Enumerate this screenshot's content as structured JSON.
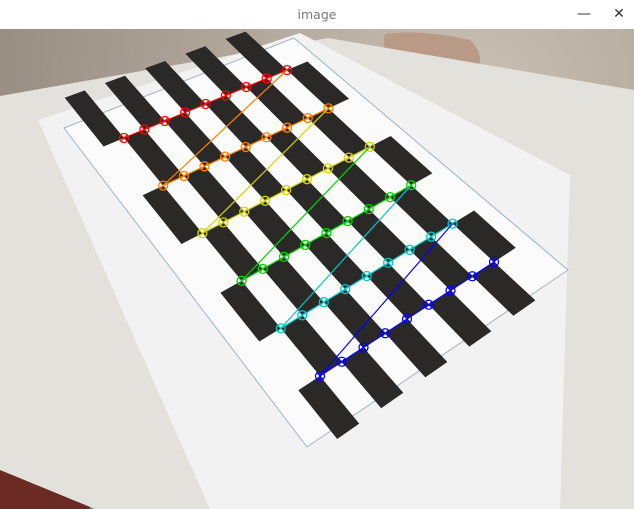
{
  "window": {
    "title": "image",
    "controls": {
      "minimize_icon": "—",
      "close_icon": "✕"
    }
  },
  "calibration": {
    "pattern": "chessboard",
    "corner_rows": 6,
    "corners_per_row": 9,
    "row_colors": [
      "#ff0000",
      "#ff7f00",
      "#d4d400",
      "#00d400",
      "#00c8c8",
      "#0000ff"
    ]
  }
}
